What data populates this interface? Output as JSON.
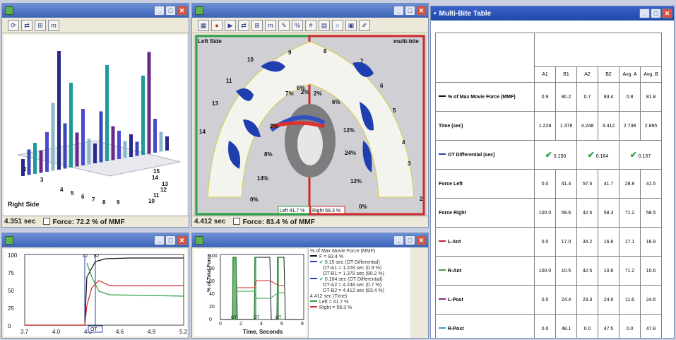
{
  "win3d": {
    "status_time": "4.351 sec",
    "status_force": "Force: 72.2 % of MMF",
    "side_label": "Right Side",
    "numbers": [
      "2",
      "3",
      "4",
      "5",
      "6",
      "7",
      "8",
      "9",
      "10",
      "11",
      "12",
      "13",
      "14",
      "15"
    ]
  },
  "arch": {
    "status_time": "4.412 sec",
    "status_force": "Force: 83.4 % of MMF",
    "left_side": "Left Side",
    "mode": "multi-bite",
    "left_pct": "Left 41.7 %",
    "right_pct": "Right 58.3 %",
    "tooth_numbers": [
      "9",
      "8",
      "7",
      "10",
      "6",
      "11",
      "5",
      "13",
      "4",
      "14",
      "3",
      "2"
    ],
    "percents": [
      "6%",
      "2%",
      "7%",
      "2%",
      "6%",
      "2%",
      "12%",
      "8%",
      "24%",
      "14%",
      "12%",
      "0%",
      "0%"
    ]
  },
  "force_chart": {
    "y_ticks": [
      "100",
      "75",
      "50",
      "25",
      "0"
    ],
    "x_ticks": [
      "3.7",
      "4.0",
      "4.3",
      "4.6",
      "4.9",
      "5.2"
    ],
    "ot_label": "OT",
    "markers": [
      "A2",
      "B2"
    ]
  },
  "time_chart": {
    "y_ticks": [
      "100",
      "80",
      "60",
      "40",
      "20",
      "0"
    ],
    "x_ticks": [
      "0",
      "2",
      "4",
      "6",
      "8"
    ],
    "ylabel": "% of Total Force",
    "xlabel": "Time, Seconds",
    "ot_labels": [
      "OT",
      "OT",
      "OT"
    ]
  },
  "legend": {
    "title": "% of Max Movie Force (MMF)",
    "force": "F = 83.4 %",
    "ot1_head": "0.15 sec (OT Differential)",
    "ot1_a": "OT-A1 = 1.228 sec (0.9 %)",
    "ot1_b": "OT-B1 = 1.378 sec (80.2 %)",
    "ot2_head": "0.164 sec (OT Differential)",
    "ot2_a": "OT-A2 = 4.248 sec (0.7 %)",
    "ot2_b": "OT-B2 = 4.412 sec (83.4 %)",
    "time": "4.412 sec (Time)",
    "left": "Left = 41.7 %",
    "right": "Right = 58.3 %"
  },
  "table": {
    "title": "Multi-Bite Table",
    "cols": [
      "A1",
      "B1",
      "A2",
      "B2",
      "Avg. A",
      "Avg. B"
    ],
    "rows": [
      {
        "label": "% of Max Movie Force (MMF)",
        "vals": [
          "0.9",
          "80.2",
          "0.7",
          "83.4",
          "0.8",
          "81.8"
        ]
      },
      {
        "label": "Time (sec)",
        "vals": [
          "1.228",
          "1.378",
          "4.248",
          "4.412",
          "2.738",
          "2.895"
        ]
      },
      {
        "label": "Force Left",
        "vals": [
          "0.0",
          "41.4",
          "57.5",
          "41.7",
          "28.8",
          "41.5"
        ]
      },
      {
        "label": "Force Right",
        "vals": [
          "100.0",
          "58.6",
          "42.5",
          "58.3",
          "71.2",
          "58.5"
        ]
      },
      {
        "label": "L-Ant",
        "vals": [
          "0.0",
          "17.0",
          "34.2",
          "16.8",
          "17.1",
          "16.9"
        ]
      },
      {
        "label": "R-Ant",
        "vals": [
          "100.0",
          "10.5",
          "42.5",
          "10.8",
          "71.2",
          "10.6"
        ]
      },
      {
        "label": "L-Post",
        "vals": [
          "0.0",
          "24.4",
          "23.3",
          "24.9",
          "11.6",
          "24.6"
        ]
      },
      {
        "label": "R-Post",
        "vals": [
          "0.0",
          "48.1",
          "0.0",
          "47.5",
          "0.0",
          "47.8"
        ]
      }
    ],
    "ot_label": "OT Differential (sec)",
    "ot_vals": [
      "0.150",
      "0.164",
      "0.157"
    ],
    "colors": {
      "ant_l": "#c0283a",
      "ant_r": "#3aa040",
      "post_l": "#8a2a8a",
      "post_r": "#2fa0c8",
      "mmf": "#111111",
      "ot": "#2a3fa8"
    }
  }
}
